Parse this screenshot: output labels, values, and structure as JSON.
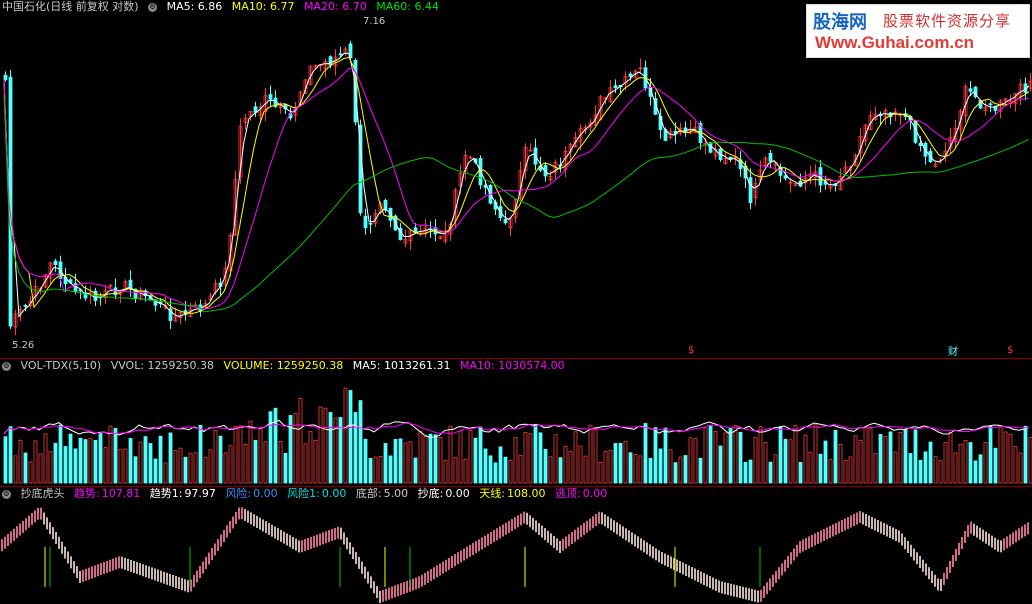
{
  "price_header": {
    "title": "中国石化(日线 前复权 对数)",
    "ma5": "MA5: 6.86",
    "ma10": "MA10: 6.77",
    "ma20": "MA20: 6.70",
    "ma60": "MA60: 6.44"
  },
  "price_labels": {
    "high": "7.16",
    "low": "5.26"
  },
  "markers": {
    "dollar": "$",
    "cai": "财"
  },
  "vol_header": {
    "title": "VOL-TDX(5,10)",
    "vvol": "VVOL: 1259250.38",
    "volume": "VOLUME: 1259250.38",
    "ma5": "MA5: 1013261.31",
    "ma10": "MA10: 1030574.00"
  },
  "ind_header": {
    "title": "抄底虎头",
    "trend_label": "趋势:",
    "trend": "107.81",
    "trend1_label": "趋势1:",
    "trend1": "97.97",
    "risk_label": "风险:",
    "risk": "0.00",
    "risk1_label": "风险1:",
    "risk1": "0.00",
    "bottom_label": "底部:",
    "bottom": "5.00",
    "buy_label": "抄底:",
    "buy": "0.00",
    "sky_label": "天线:",
    "sky": "108.00",
    "escape_label": "逃顶:",
    "escape": "0.00"
  },
  "logo": {
    "name": "股海网",
    "slogan": "股票软件资源分享",
    "url": "Www.Guhai.com.cn"
  },
  "colors": {
    "up": "#ff3c3c",
    "down": "#54ffff",
    "ma5": "#ffffff",
    "ma10": "#ffff00",
    "ma20": "#ff00ff",
    "ma60": "#00c000",
    "ind_up": "#d46a8a",
    "ind_down": "#c8b8b0",
    "bg": "#000000",
    "separator": "#8b0000"
  }
}
